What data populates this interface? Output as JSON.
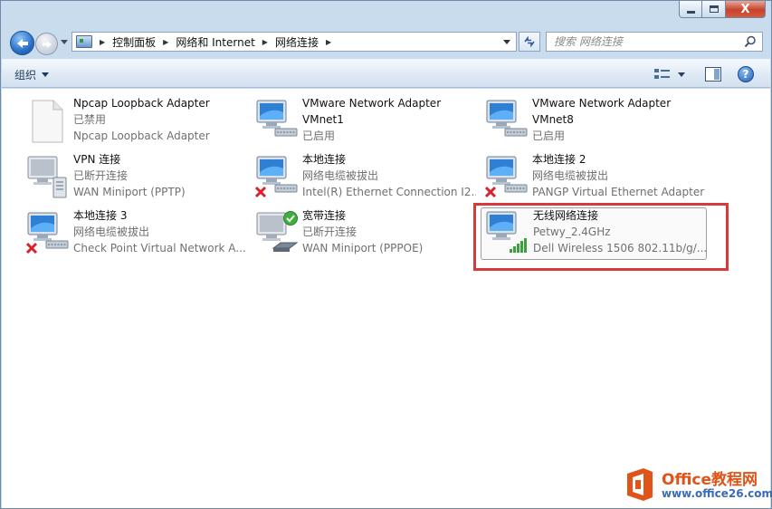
{
  "caption": {
    "minimize_label": "",
    "maximize_label": "",
    "close_label": "X"
  },
  "address": {
    "crumbs": [
      "控制面板",
      "网络和 Internet",
      "网络连接"
    ]
  },
  "search": {
    "placeholder": "搜索 网络连接"
  },
  "toolbar": {
    "organize_label": "组织",
    "help_label": "?"
  },
  "connections": [
    {
      "name": "Npcap Loopback Adapter",
      "status": "已禁用",
      "device": "Npcap Loopback Adapter",
      "icon": "disabled-page-icon"
    },
    {
      "name": "VMware Network Adapter",
      "status": "VMnet1",
      "device": "已启用",
      "icon": "lan-monitor-icon"
    },
    {
      "name": "VMware Network Adapter",
      "status": "VMnet8",
      "device": "已启用",
      "icon": "lan-monitor-icon"
    },
    {
      "name": "VPN 连接",
      "status": "已断开连接",
      "device": "WAN Miniport (PPTP)",
      "icon": "vpn-monitor-icon"
    },
    {
      "name": "本地连接",
      "status": "网络电缆被拔出",
      "device": "Intel(R) Ethernet Connection I2...",
      "icon": "lan-unplugged-icon"
    },
    {
      "name": "本地连接 2",
      "status": "网络电缆被拔出",
      "device": "PANGP Virtual Ethernet Adapter",
      "icon": "lan-unplugged-icon"
    },
    {
      "name": "本地连接 3",
      "status": "网络电缆被拔出",
      "device": "Check Point Virtual Network A...",
      "icon": "lan-unplugged-icon"
    },
    {
      "name": "宽带连接",
      "status": "已断开连接",
      "device": "WAN Miniport (PPPOE)",
      "icon": "broadband-monitor-icon"
    },
    {
      "name": "无线网络连接",
      "status": "Petwy_2.4GHz",
      "device": "Dell Wireless 1506 802.11b/g/...",
      "icon": "wireless-monitor-icon"
    }
  ],
  "watermark": {
    "title": "Office教程网",
    "url": "www.office26.com"
  },
  "colors": {
    "highlight": "#d8393a",
    "accent_orange": "#e0541a",
    "accent_blue": "#3a6bb5"
  }
}
